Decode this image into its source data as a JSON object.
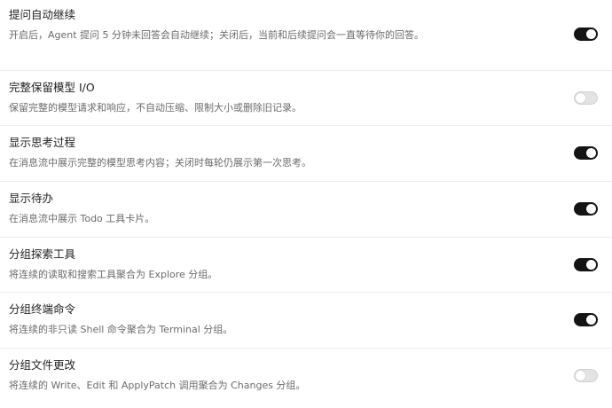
{
  "settings": [
    {
      "title": "提问自动继续",
      "description": "开启后，Agent 提问 5 分钟未回答会自动继续；关闭后，当前和后续提问会一直等待你的回答。",
      "enabled": true
    },
    {
      "title": "完整保留模型 I/O",
      "description": "保留完整的模型请求和响应，不自动压缩、限制大小或删除旧记录。",
      "enabled": false
    },
    {
      "title": "显示思考过程",
      "description": "在消息流中展示完整的模型思考内容；关闭时每轮仍展示第一次思考。",
      "enabled": true
    },
    {
      "title": "显示待办",
      "description": "在消息流中展示 Todo 工具卡片。",
      "enabled": true
    },
    {
      "title": "分组探索工具",
      "description": "将连续的读取和搜索工具聚合为 Explore 分组。",
      "enabled": true
    },
    {
      "title": "分组终端命令",
      "description": "将连续的非只读 Shell 命令聚合为 Terminal 分组。",
      "enabled": true
    },
    {
      "title": "分组文件更改",
      "description": "将连续的 Write、Edit 和 ApplyPatch 调用聚合为 Changes 分组。",
      "enabled": false
    }
  ]
}
